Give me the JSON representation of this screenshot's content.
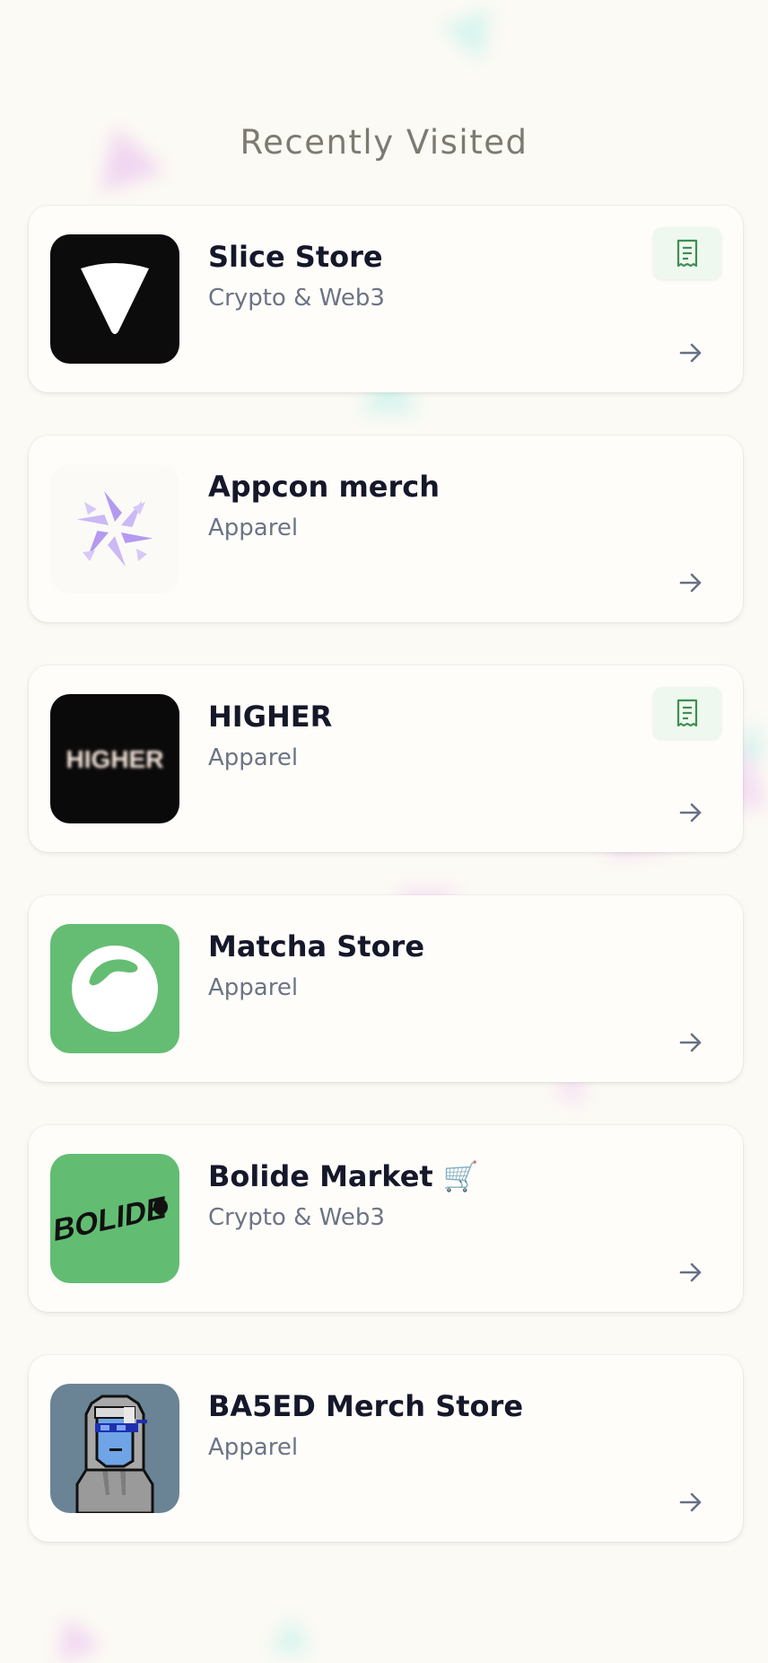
{
  "header": {
    "title": "Recently Visited"
  },
  "stores": [
    {
      "name": "Slice Store",
      "category": "Crypto & Web3",
      "logo_icon": "slice-logo",
      "logo_bg": "#0d0c0c",
      "has_receipt": true
    },
    {
      "name": "Appcon merch",
      "category": "Apparel",
      "logo_icon": "appcon-logo",
      "logo_bg": "#fbfaf6",
      "has_receipt": false
    },
    {
      "name": "HIGHER",
      "category": "Apparel",
      "logo_icon": "higher-logo",
      "logo_text": "HIGHER",
      "logo_bg": "#0b0a0a",
      "has_receipt": true
    },
    {
      "name": "Matcha Store",
      "category": "Apparel",
      "logo_icon": "matcha-logo",
      "logo_bg": "#65bd73",
      "has_receipt": false
    },
    {
      "name": "Bolide Market 🛒",
      "category": "Crypto & Web3",
      "logo_icon": "bolide-logo",
      "logo_text": "BOLIDE",
      "logo_bg": "#62bd72",
      "has_receipt": false
    },
    {
      "name": "BA5ED Merch Store",
      "category": "Apparel",
      "logo_icon": "ba5ed-avatar-logo",
      "logo_bg": "#6a8496",
      "has_receipt": false
    }
  ],
  "icons": {
    "receipt": "receipt-icon",
    "arrow": "arrow-right-icon"
  },
  "colors": {
    "background": "#fcfaf4",
    "card": "#fefdfa",
    "title": "#7d7a72",
    "store_name": "#15182a",
    "category": "#6c7484",
    "receipt_bg": "#eef8ef",
    "receipt_icon": "#3f8f51",
    "arrow": "#687086"
  }
}
